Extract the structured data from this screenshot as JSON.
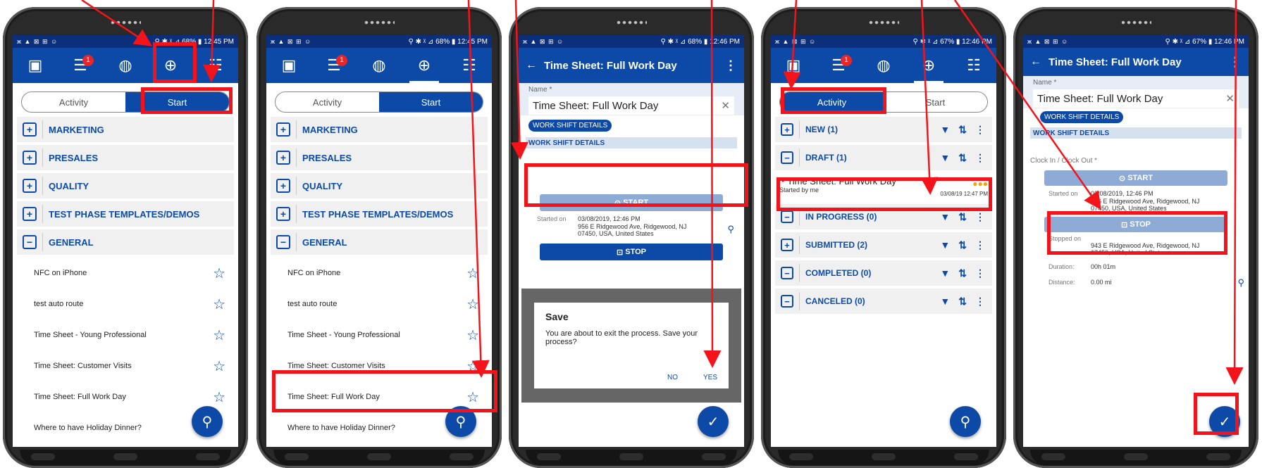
{
  "status": {
    "p1": {
      "left": "ж ▲ ⊠ ⊞ ☺",
      "right": "⚲ ✱ ᵡ ⊿ 68% ▮ 12:45 PM"
    },
    "p2": {
      "left": "ж ▲ ⊠ ⊞ ☺",
      "right": "⚲ ✱ ᵡ ⊿ 68% ▮ 12:45 PM"
    },
    "p3": {
      "left": "ж ▲ ⊠ ⊞ ☺",
      "right": "⚲ ✱ ᵡ ⊿ 68% ▮ 12:46 PM"
    },
    "p4": {
      "left": "ж ▲ ⊠ ⊞ ☺",
      "right": "⚲ ✱ ᵡ ⊿ 67% ▮ 12:46 PM"
    },
    "p5": {
      "left": "ж ▲ ⊠ ⊞ ☺",
      "right": "⚲ ✱ ᵡ ⊿ 67% ▮ 12:46 PM"
    }
  },
  "tabs": {
    "badge": "1"
  },
  "segment": {
    "activity": "Activity",
    "start": "Start"
  },
  "categories": [
    "MARKETING",
    "PRESALES",
    "QUALITY",
    "TEST PHASE TEMPLATES/DEMOS",
    "GENERAL"
  ],
  "processes": [
    "NFC on iPhone",
    "test auto route",
    "Time Sheet - Young Professional",
    "Time Sheet: Customer Visits",
    "Time Sheet: Full Work Day",
    "Where to have Holiday Dinner?"
  ],
  "form": {
    "title": "Time Sheet: Full Work Day",
    "name_label": "Name *",
    "name_value": "Time Sheet: Full Work Day",
    "pill": "WORK SHIFT DETAILS",
    "section": "WORK SHIFT DETAILS",
    "clock_label": "Clock In / Clock Out *",
    "start": "START",
    "stop": "STOP",
    "started_on_label": "Started on",
    "started_on_value": "03/08/2019, 12:46 PM",
    "address1": "956 E Ridgewood Ave, Ridgewood, NJ 07450, USA, United States",
    "stopped_on_label": "Stopped on",
    "address2": "943 E Ridgewood Ave, Ridgewood, NJ 07450, USA, United States",
    "duration_label": "Duration:",
    "duration_value": "00h 01m",
    "distance_label": "Distance:",
    "distance_value": "0.00 mi"
  },
  "dialog": {
    "title": "Save",
    "message": "You are about to exit the process. Save your process?",
    "no": "NO",
    "yes": "YES"
  },
  "groups": [
    {
      "label": "NEW (1)",
      "state": "+"
    },
    {
      "label": "DRAFT (1)",
      "state": "−"
    },
    {
      "label": "IN PROGRESS (0)",
      "state": "−"
    },
    {
      "label": "SUBMITTED (2)",
      "state": "+"
    },
    {
      "label": "COMPLETED (0)",
      "state": "−"
    },
    {
      "label": "CANCELED (0)",
      "state": "−"
    }
  ],
  "draft": {
    "title": "Time Sheet: Full Work Day",
    "sub": "Started by me",
    "date": "03/08/19 12:47 PM"
  },
  "icons": {
    "search": "search-icon",
    "check": "check-icon"
  },
  "colors": {
    "primary": "#0d4aa8",
    "highlight": "#f2141a",
    "status": "#0b2f7a"
  }
}
